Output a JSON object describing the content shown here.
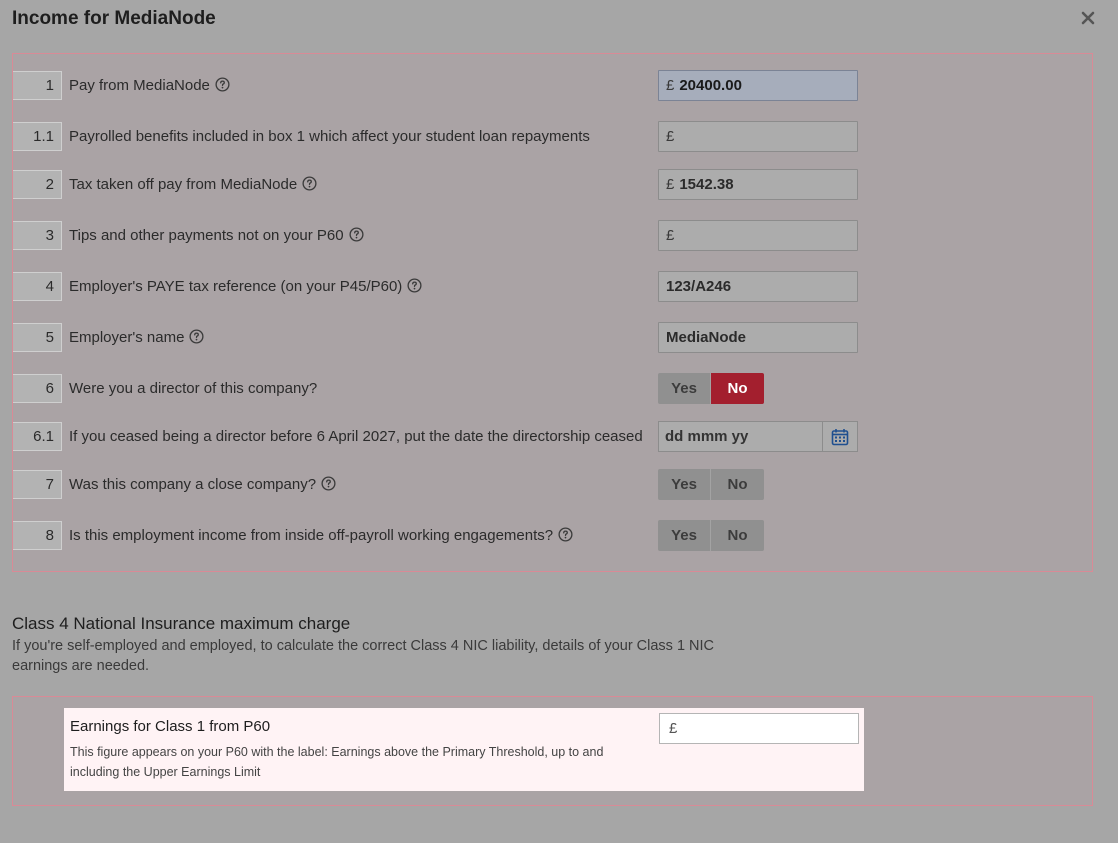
{
  "dialog": {
    "title": "Income for MediaNode",
    "close_icon": "close-icon"
  },
  "currency_symbol": "£",
  "rows": {
    "r1": {
      "num": "1",
      "label": "Pay from MediaNode",
      "value": "20400.00"
    },
    "r1_1": {
      "num": "1.1",
      "label": "Payrolled benefits included in box 1 which affect your student loan repayments",
      "value": ""
    },
    "r2": {
      "num": "2",
      "label": "Tax taken off pay from MediaNode",
      "value": "1542.38"
    },
    "r3": {
      "num": "3",
      "label": "Tips and other payments not on your P60",
      "value": ""
    },
    "r4": {
      "num": "4",
      "label": "Employer's PAYE tax reference (on your P45/P60)",
      "value": "123/A246"
    },
    "r5": {
      "num": "5",
      "label": "Employer's name",
      "value": "MediaNode"
    },
    "r6": {
      "num": "6",
      "label": "Were you a director of this company?",
      "yes": "Yes",
      "no": "No",
      "selected": "No"
    },
    "r6_1": {
      "num": "6.1",
      "label": "If you ceased being a director before 6 April 2027, put the date the directorship ceased",
      "placeholder": "dd mmm yy"
    },
    "r7": {
      "num": "7",
      "label": "Was this company a close company?",
      "yes": "Yes",
      "no": "No",
      "selected": ""
    },
    "r8": {
      "num": "8",
      "label": "Is this employment income from inside off-payroll working engagements?",
      "yes": "Yes",
      "no": "No",
      "selected": ""
    }
  },
  "class4": {
    "title": "Class 4 National Insurance maximum charge",
    "description": "If you're self-employed and employed, to calculate the correct Class 4 NIC liability, details of your Class 1 NIC earnings are needed.",
    "field_label": "Earnings for Class 1 from P60",
    "field_help": "This figure appears on your P60 with the label: Earnings above the Primary Threshold, up to and including the Upper Earnings Limit",
    "value": ""
  },
  "colors": {
    "accent_red": "#a31f2e",
    "panel_border": "#d98a96",
    "highlight_bg": "#fff3f5"
  }
}
